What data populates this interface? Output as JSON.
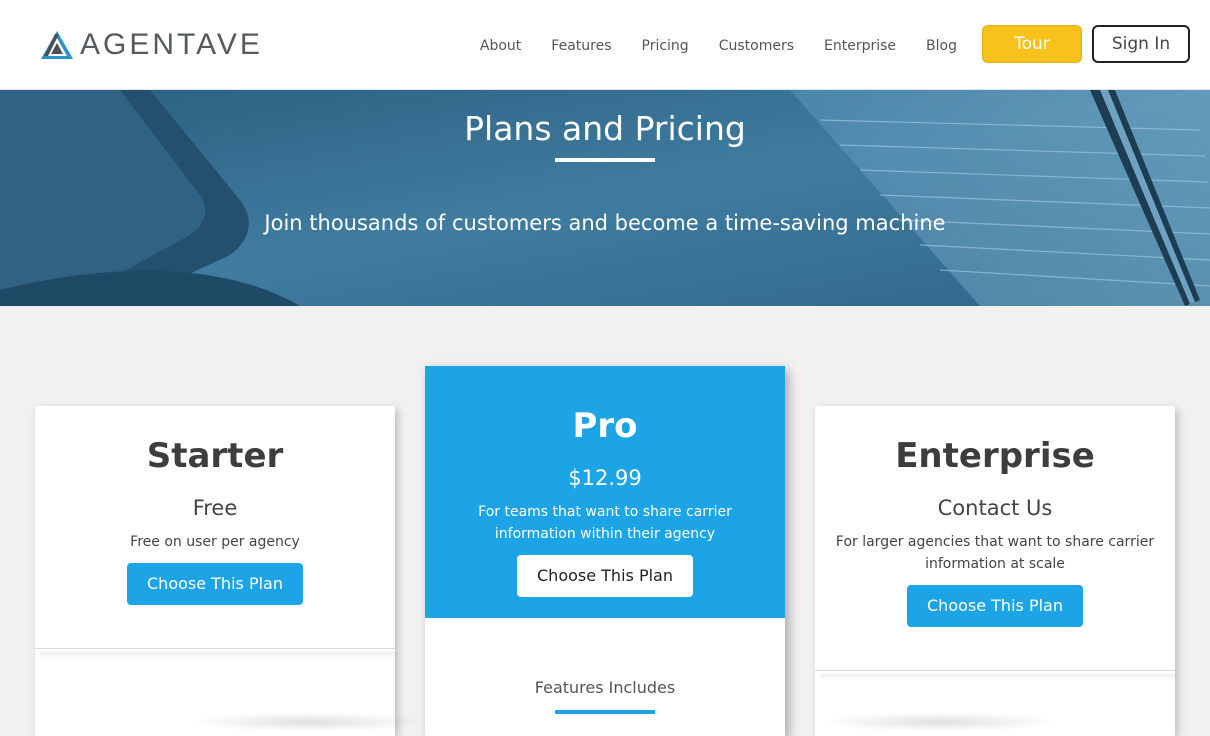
{
  "brand": {
    "name": "AGENTAVE",
    "logo_icon": "triangle-logo-icon",
    "colors": {
      "accent": "#1ca4e6",
      "tour": "#f8c21c"
    }
  },
  "nav": {
    "items": [
      {
        "label": "About"
      },
      {
        "label": "Features"
      },
      {
        "label": "Pricing"
      },
      {
        "label": "Customers"
      },
      {
        "label": "Enterprise"
      },
      {
        "label": "Blog"
      }
    ],
    "tour_label": "Tour",
    "signin_label": "Sign In"
  },
  "hero": {
    "title": "Plans and Pricing",
    "subtitle": "Join thousands of customers and become a time-saving machine"
  },
  "plans": [
    {
      "name": "Starter",
      "price": "Free",
      "description": "Free on user per agency",
      "button": "Choose This Plan"
    },
    {
      "name": "Pro",
      "price": "$12.99",
      "description": "For teams that want to share carrier information within their agency",
      "button": "Choose This Plan",
      "features_title": "Features Includes"
    },
    {
      "name": "Enterprise",
      "price": "Contact Us",
      "description": "For larger agencies that want to share carrier information at scale",
      "button": "Choose This Plan"
    }
  ]
}
